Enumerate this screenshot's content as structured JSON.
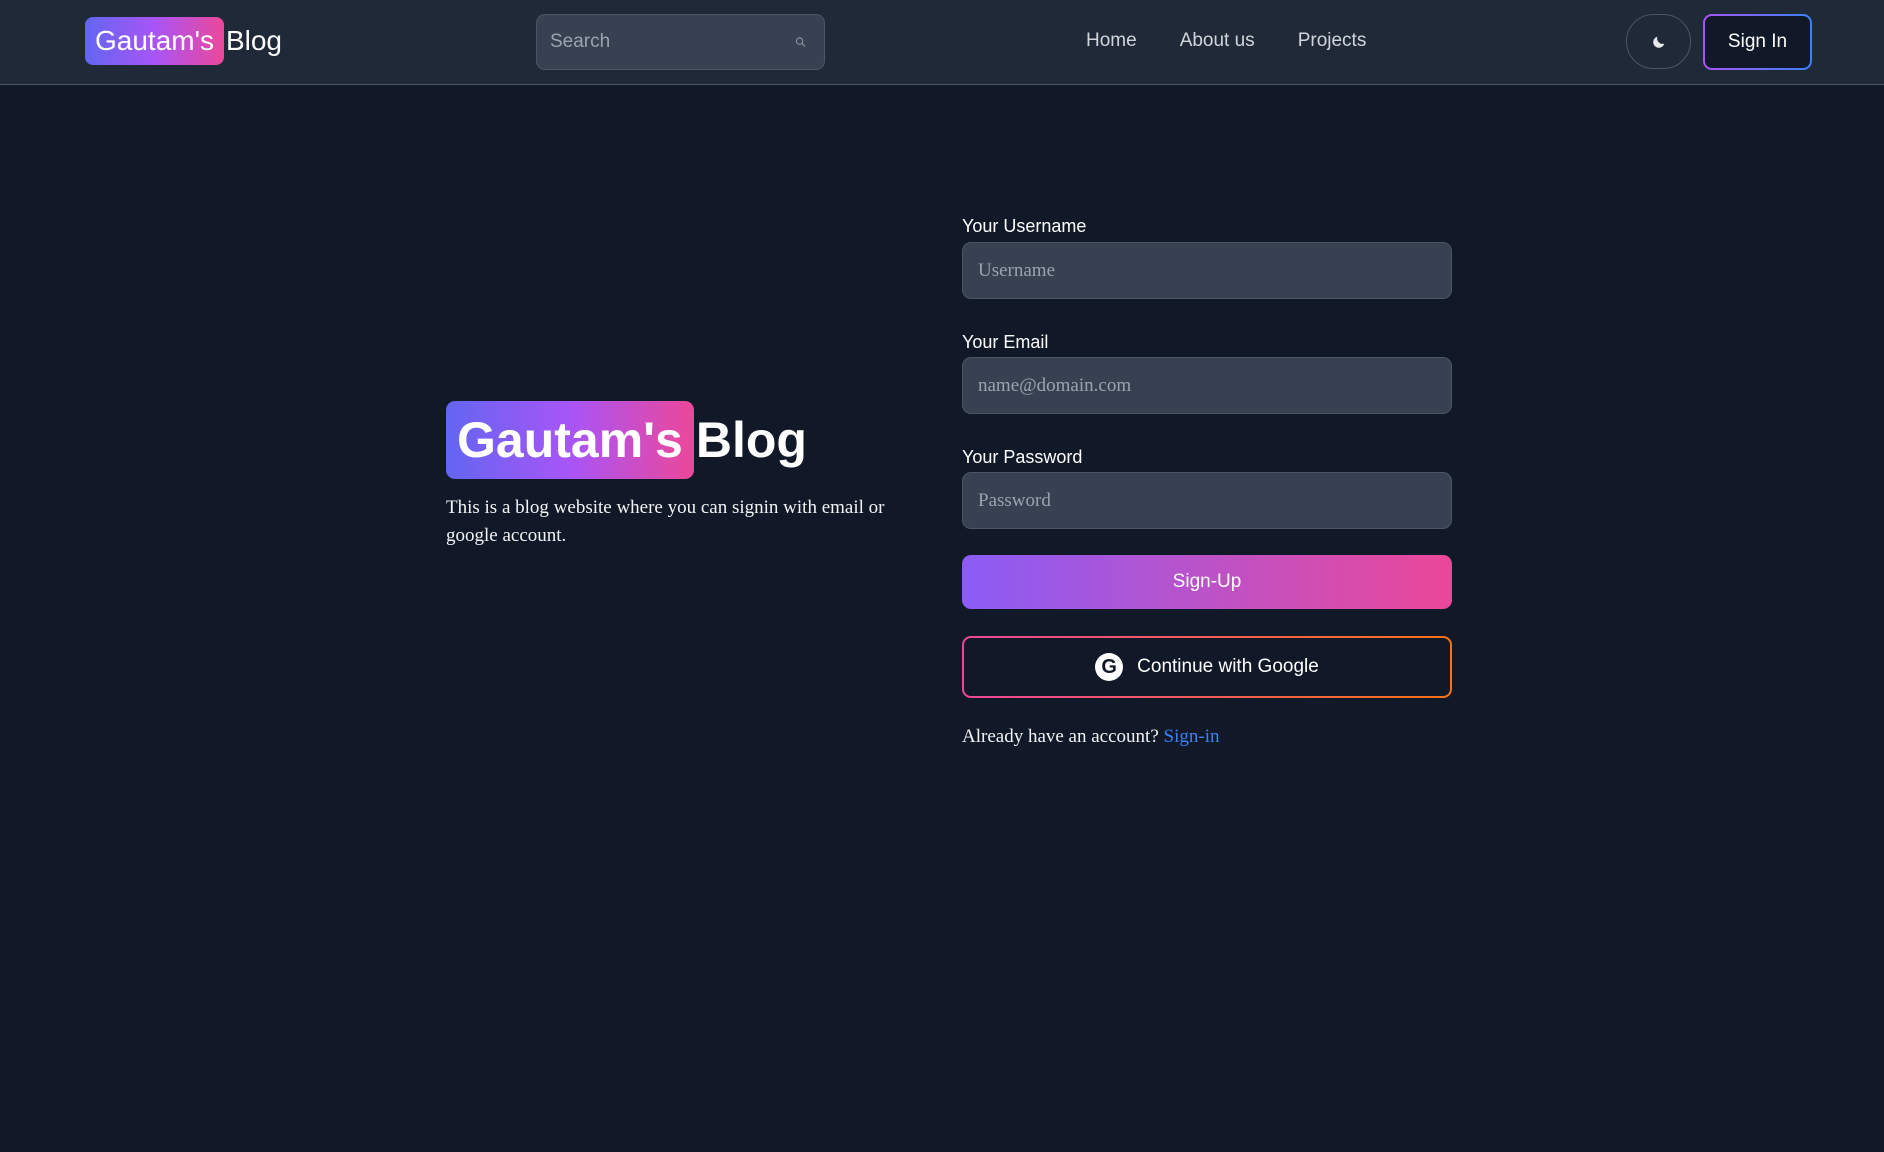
{
  "header": {
    "logo_highlight": "Gautam's",
    "logo_rest": "Blog",
    "search_placeholder": "Search",
    "nav": [
      "Home",
      "About us",
      "Projects"
    ],
    "theme_icon": "moon-icon",
    "signin_label": "Sign In"
  },
  "hero": {
    "logo_highlight": "Gautam's",
    "logo_rest": "Blog",
    "description": "This is a blog website where you can signin with email or google account."
  },
  "form": {
    "username_label": "Your Username",
    "username_placeholder": "Username",
    "email_label": "Your Email",
    "email_placeholder": "name@domain.com",
    "password_label": "Your Password",
    "password_placeholder": "Password",
    "signup_label": "Sign-Up",
    "google_label": "Continue with Google",
    "google_icon_letter": "G",
    "already_text": "Already have an account?",
    "signin_link": "Sign-in"
  },
  "colors": {
    "background": "#111827",
    "header": "#1f2937",
    "input": "#374151",
    "gradient_start": "#8b5cf6",
    "gradient_end": "#ec4899",
    "link": "#3b82f6"
  }
}
